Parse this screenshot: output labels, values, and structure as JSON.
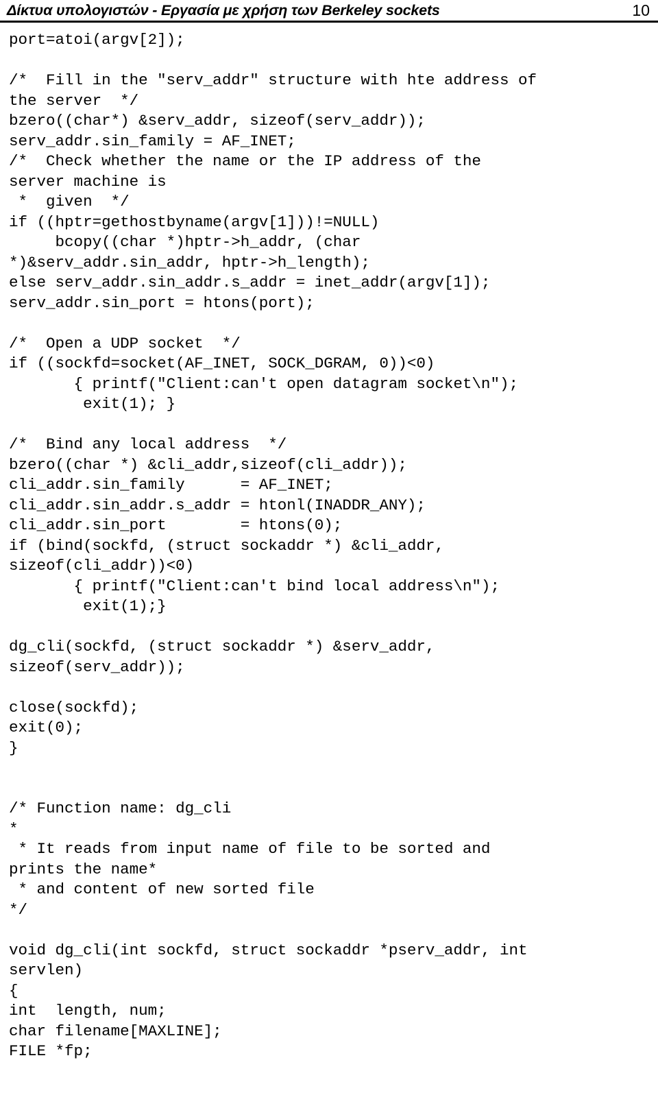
{
  "header": {
    "title": "Δίκτυα υπολογιστών - Εργασία με χρήση των Berkeley sockets",
    "page_number": "10"
  },
  "code": {
    "lines": [
      "port=atoi(argv[2]);",
      "",
      "/*  Fill in the \"serv_addr\" structure with hte address of",
      "the server  */",
      "bzero((char*) &serv_addr, sizeof(serv_addr));",
      "serv_addr.sin_family = AF_INET;",
      "/*  Check whether the name or the IP address of the",
      "server machine is",
      " *  given  */",
      "if ((hptr=gethostbyname(argv[1]))!=NULL)",
      "     bcopy((char *)hptr->h_addr, (char",
      "*)&serv_addr.sin_addr, hptr->h_length);",
      "else serv_addr.sin_addr.s_addr = inet_addr(argv[1]);",
      "serv_addr.sin_port = htons(port);",
      "",
      "/*  Open a UDP socket  */",
      "if ((sockfd=socket(AF_INET, SOCK_DGRAM, 0))<0)",
      "       { printf(\"Client:can't open datagram socket\\n\");",
      "        exit(1); }",
      "",
      "/*  Bind any local address  */",
      "bzero((char *) &cli_addr,sizeof(cli_addr));",
      "cli_addr.sin_family      = AF_INET;",
      "cli_addr.sin_addr.s_addr = htonl(INADDR_ANY);",
      "cli_addr.sin_port        = htons(0);",
      "if (bind(sockfd, (struct sockaddr *) &cli_addr,",
      "sizeof(cli_addr))<0)",
      "       { printf(\"Client:can't bind local address\\n\");",
      "        exit(1);}",
      "",
      "dg_cli(sockfd, (struct sockaddr *) &serv_addr,",
      "sizeof(serv_addr));",
      "",
      "close(sockfd);",
      "exit(0);",
      "}",
      "",
      "",
      "/* Function name: dg_cli",
      "*",
      " * It reads from input name of file to be sorted and",
      "prints the name*",
      " * and content of new sorted file",
      "*/",
      "",
      "void dg_cli(int sockfd, struct sockaddr *pserv_addr, int",
      "servlen)",
      "{",
      "int  length, num;",
      "char filename[MAXLINE];",
      "FILE *fp;"
    ]
  }
}
